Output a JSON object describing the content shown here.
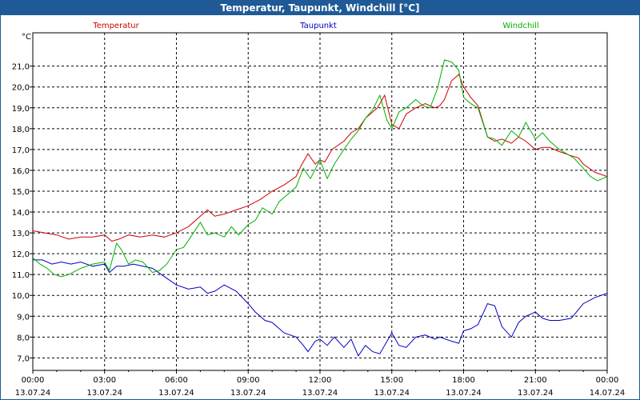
{
  "title": "Temperatur, Taupunkt, Windchill [°C]",
  "colors": {
    "titlebar": "#1f5a96",
    "temperatur": "#d00000",
    "taupunkt": "#0000c0",
    "windchill": "#00b000",
    "grid": "#000000"
  },
  "chart_data": {
    "type": "line",
    "ylabel": "°C",
    "ylim": [
      6.4,
      22.6
    ],
    "yticks": [
      7.0,
      8.0,
      9.0,
      10.0,
      11.0,
      12.0,
      13.0,
      14.0,
      15.0,
      16.0,
      17.0,
      18.0,
      19.0,
      20.0,
      21.0
    ],
    "ytick_labels": [
      "7,0",
      "8,0",
      "9,0",
      "10,0",
      "11,0",
      "12,0",
      "13,0",
      "14,0",
      "15,0",
      "16,0",
      "17,0",
      "18,0",
      "19,0",
      "20,0",
      "21,0"
    ],
    "xlim": [
      0,
      24
    ],
    "xticks": [
      0,
      3,
      6,
      9,
      12,
      15,
      18,
      21,
      24
    ],
    "xtick_times": [
      "00:00",
      "03:00",
      "06:00",
      "09:00",
      "12:00",
      "15:00",
      "18:00",
      "21:00",
      "00:00"
    ],
    "xtick_dates": [
      "13.07.24",
      "13.07.24",
      "13.07.24",
      "13.07.24",
      "13.07.24",
      "13.07.24",
      "13.07.24",
      "13.07.24",
      "14.07.24"
    ],
    "grid": true,
    "legend_placement": "top",
    "series": [
      {
        "name": "Temperatur",
        "color": "#d00000",
        "x": [
          0,
          0.5,
          1,
          1.5,
          2,
          2.5,
          3,
          3.3,
          3.6,
          4,
          4.5,
          5,
          5.5,
          6,
          6.5,
          7,
          7.3,
          7.6,
          8,
          8.5,
          9,
          9.5,
          10,
          10.5,
          11,
          11.2,
          11.5,
          11.8,
          12,
          12.2,
          12.5,
          13,
          13.3,
          13.6,
          13.9,
          14.1,
          14.4,
          14.7,
          15,
          15.3,
          15.6,
          16,
          16.4,
          16.8,
          17,
          17.2,
          17.5,
          17.8,
          18,
          18.3,
          18.6,
          19,
          19.3,
          19.6,
          20,
          20.3,
          20.6,
          21,
          21.3,
          21.6,
          22,
          22.5,
          22.8,
          23,
          23.5,
          24
        ],
        "y": [
          13.1,
          13.0,
          12.9,
          12.7,
          12.8,
          12.8,
          12.9,
          12.6,
          12.7,
          12.9,
          12.8,
          12.9,
          12.8,
          13.0,
          13.3,
          13.8,
          14.1,
          13.8,
          13.9,
          14.1,
          14.3,
          14.6,
          15.0,
          15.3,
          15.7,
          16.2,
          16.8,
          16.3,
          16.5,
          16.4,
          17.0,
          17.4,
          17.8,
          18.0,
          18.5,
          18.7,
          19.0,
          19.6,
          18.2,
          18.0,
          18.7,
          19.0,
          19.2,
          19.0,
          19.1,
          19.4,
          20.3,
          20.6,
          20.0,
          19.5,
          19.1,
          17.6,
          17.4,
          17.5,
          17.3,
          17.6,
          17.4,
          17.0,
          17.1,
          17.1,
          16.9,
          16.7,
          16.6,
          16.3,
          15.9,
          15.7
        ]
      },
      {
        "name": "Taupunkt",
        "color": "#0000c0",
        "x": [
          0,
          0.4,
          0.8,
          1.2,
          1.6,
          2,
          2.5,
          3,
          3.2,
          3.5,
          3.8,
          4.2,
          4.6,
          5,
          5.5,
          6,
          6.5,
          7,
          7.3,
          7.6,
          8,
          8.5,
          9,
          9.3,
          9.7,
          10,
          10.5,
          11,
          11.3,
          11.5,
          11.8,
          12,
          12.3,
          12.6,
          13,
          13.3,
          13.6,
          13.9,
          14.2,
          14.5,
          14.8,
          15,
          15.3,
          15.6,
          16,
          16.4,
          16.8,
          17,
          17.5,
          17.8,
          18,
          18.3,
          18.6,
          19,
          19.3,
          19.6,
          20,
          20.3,
          20.6,
          21,
          21.3,
          21.6,
          22,
          22.5,
          23,
          23.5,
          24
        ],
        "y": [
          11.7,
          11.7,
          11.5,
          11.6,
          11.5,
          11.6,
          11.4,
          11.5,
          11.1,
          11.4,
          11.4,
          11.5,
          11.4,
          11.3,
          10.9,
          10.5,
          10.3,
          10.4,
          10.1,
          10.2,
          10.5,
          10.2,
          9.6,
          9.2,
          8.8,
          8.7,
          8.2,
          8.0,
          7.6,
          7.3,
          7.8,
          7.9,
          7.6,
          8.0,
          7.5,
          7.9,
          7.1,
          7.6,
          7.3,
          7.2,
          7.8,
          8.2,
          7.6,
          7.5,
          8.0,
          8.1,
          7.9,
          8.0,
          7.8,
          7.7,
          8.3,
          8.4,
          8.6,
          9.6,
          9.5,
          8.5,
          8.0,
          8.7,
          9.0,
          9.2,
          8.9,
          8.8,
          8.8,
          8.9,
          9.6,
          9.9,
          10.1
        ]
      },
      {
        "name": "Windchill",
        "color": "#00b000",
        "x": [
          0,
          0.3,
          0.6,
          0.9,
          1.2,
          1.5,
          2,
          2.5,
          3,
          3.2,
          3.5,
          3.7,
          4,
          4.3,
          4.6,
          5,
          5.3,
          5.6,
          6,
          6.3,
          6.6,
          7,
          7.3,
          7.6,
          8,
          8.3,
          8.6,
          9,
          9.3,
          9.6,
          10,
          10.3,
          10.6,
          11,
          11.3,
          11.6,
          12,
          12.3,
          12.6,
          13,
          13.3,
          13.6,
          13.9,
          14.2,
          14.5,
          14.8,
          15,
          15.3,
          15.6,
          16,
          16.3,
          16.6,
          16.9,
          17.2,
          17.5,
          17.8,
          18,
          18.3,
          18.6,
          19,
          19.3,
          19.6,
          20,
          20.3,
          20.6,
          21,
          21.3,
          21.6,
          22,
          22.3,
          22.6,
          23,
          23.3,
          23.6,
          24
        ],
        "y": [
          11.8,
          11.5,
          11.3,
          11.0,
          10.9,
          11.0,
          11.3,
          11.5,
          11.6,
          11.2,
          12.5,
          12.2,
          11.5,
          11.7,
          11.6,
          11.1,
          11.2,
          11.5,
          12.2,
          12.3,
          12.8,
          13.5,
          12.9,
          13.0,
          12.8,
          13.3,
          12.9,
          13.4,
          13.6,
          14.2,
          13.9,
          14.5,
          14.8,
          15.2,
          16.1,
          15.6,
          16.5,
          15.6,
          16.3,
          17.0,
          17.5,
          17.9,
          18.5,
          18.9,
          19.6,
          18.4,
          18.0,
          18.8,
          19.0,
          19.4,
          19.1,
          19.0,
          19.9,
          21.3,
          21.2,
          20.8,
          19.5,
          19.2,
          19.0,
          17.6,
          17.5,
          17.2,
          17.9,
          17.6,
          18.3,
          17.5,
          17.8,
          17.4,
          17.0,
          16.8,
          16.6,
          16.1,
          15.7,
          15.5,
          15.7
        ]
      }
    ]
  }
}
